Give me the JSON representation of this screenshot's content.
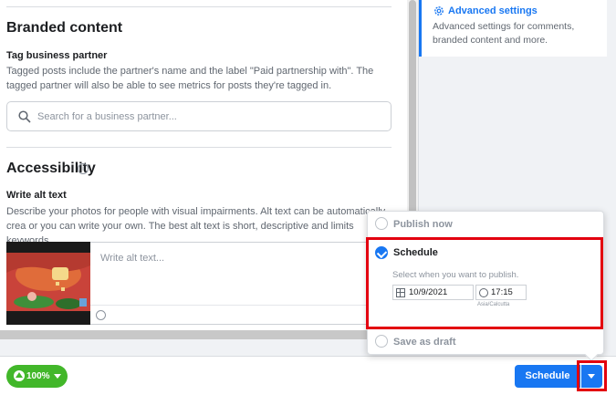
{
  "branded": {
    "title": "Branded content",
    "tag_title": "Tag business partner",
    "tag_desc": "Tagged posts include the partner's name and the label \"Paid partnership with\". The tagged partner will also be able to see metrics for posts they're tagged in.",
    "search_placeholder": "Search for a business partner..."
  },
  "accessibility": {
    "title": "Accessibility",
    "alt_title": "Write alt text",
    "alt_desc": "Describe your photos for people with visual impairments. Alt text can be automatically crea or you can write your own. The best alt text is short, descriptive and limits keywords.",
    "alt_placeholder": "Write alt text..."
  },
  "advanced": {
    "title": "Advanced settings",
    "desc": "Advanced settings for comments, branded content and more."
  },
  "upload": {
    "progress": "100%"
  },
  "schedule_menu": {
    "publish_now": "Publish now",
    "schedule": "Schedule",
    "schedule_hint": "Select when you want to publish.",
    "date": "10/9/2021",
    "time": "17:15",
    "timezone": "Asia/Calcutta",
    "save_draft": "Save as draft"
  },
  "footer": {
    "schedule_button": "Schedule"
  },
  "colors": {
    "accent": "#1877f2",
    "success": "#42b72a",
    "highlight": "#e3000f"
  },
  "icons": [
    "search-icon",
    "info-icon",
    "gear-icon",
    "upload-icon",
    "calendar-icon",
    "clock-icon",
    "emoji-icon",
    "caret-down-icon",
    "check-icon"
  ]
}
